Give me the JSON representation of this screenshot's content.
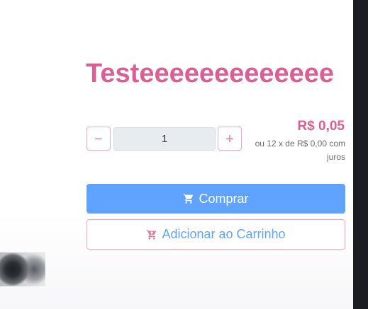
{
  "product": {
    "title": "Testeeeeeeeeeeeee"
  },
  "quantity": {
    "minus_symbol": "−",
    "plus_symbol": "+",
    "value": "1"
  },
  "price": {
    "main": "R$ 0,05",
    "installment": "ou 12 x de R$ 0,00 com juros"
  },
  "actions": {
    "buy_label": "Comprar",
    "add_to_cart_label": "Adicionar ao Carrinho"
  },
  "icons": {
    "buy": "cart-icon",
    "add_to_cart": "cart-plus-icon"
  },
  "colors": {
    "accent_pink": "#db5f92",
    "primary_blue": "#5fa3ff",
    "border_pink": "#f1a7c2"
  }
}
